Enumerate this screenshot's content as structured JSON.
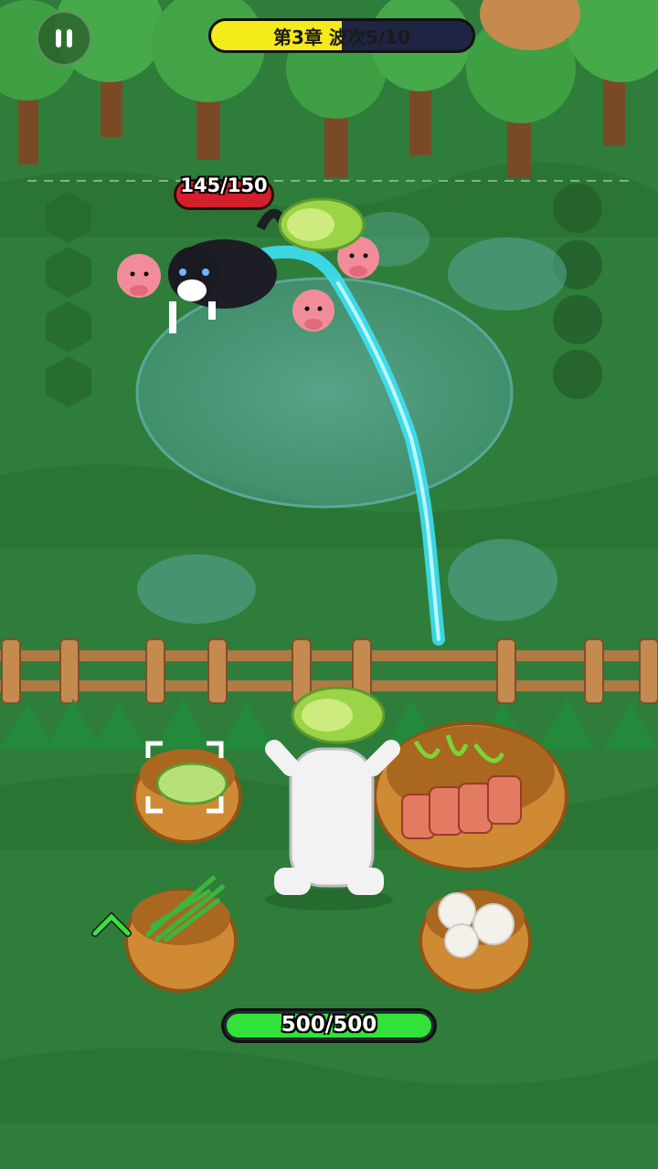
{
  "hud": {
    "chapter_wave_label": "第3章 波次5/10",
    "wave_progress": 0.5
  },
  "enemy": {
    "hp_label": "145/150",
    "hp_current": 145,
    "hp_max": 150
  },
  "player": {
    "hp_label": "500/500",
    "hp_current": 500,
    "hp_max": 500
  },
  "baskets": [
    {
      "item": "cabbage",
      "selected": true
    },
    {
      "item": "meat-and-vegetables"
    },
    {
      "item": "chives"
    },
    {
      "item": "dumplings"
    }
  ],
  "colors": {
    "grass": "#2f7d3a",
    "progress_fill": "#f5ea1a",
    "enemy_hp": "#d41f2c",
    "player_hp": "#32e13a",
    "water_stream": "#3ee0f5"
  }
}
